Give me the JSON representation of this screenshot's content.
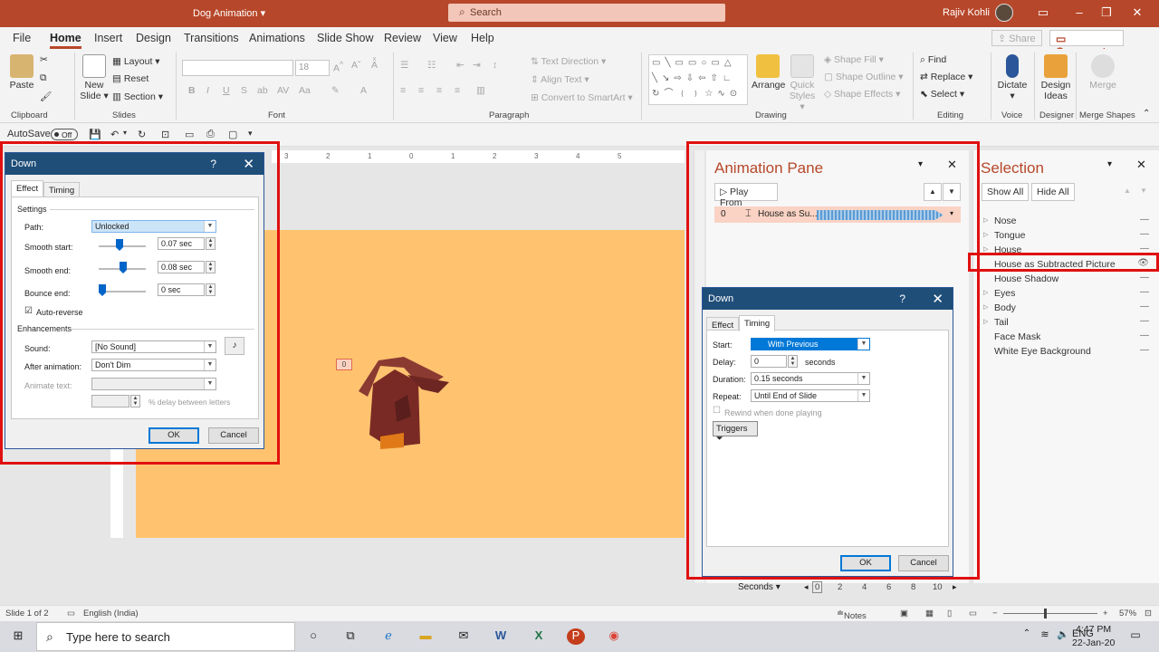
{
  "titlebar": {
    "doc_title": "Dog Animation ▾",
    "search_placeholder": "Search",
    "user": "Rajiv Kohli"
  },
  "tabs": [
    "File",
    "Home",
    "Insert",
    "Design",
    "Transitions",
    "Animations",
    "Slide Show",
    "Review",
    "View",
    "Help"
  ],
  "share": "Share",
  "comments": "Comments",
  "ribbon": {
    "clipboard": {
      "paste": "Paste",
      "label": "Clipboard"
    },
    "slides": {
      "new_slide": "New Slide ▾",
      "layout": "Layout ▾",
      "reset": "Reset",
      "section": "Section ▾",
      "label": "Slides"
    },
    "font": {
      "size": "18",
      "label": "Font"
    },
    "paragraph": {
      "text_direction": "Text Direction ▾",
      "align_text": "Align Text ▾",
      "convert": "Convert to SmartArt ▾",
      "label": "Paragraph"
    },
    "drawing": {
      "arrange": "Arrange",
      "quick_styles": "Quick Styles ▾",
      "shape_fill": "Shape Fill ▾",
      "shape_outline": "Shape Outline ▾",
      "shape_effects": "Shape Effects ▾",
      "label": "Drawing"
    },
    "editing": {
      "find": "Find",
      "replace": "Replace ▾",
      "select": "Select ▾",
      "label": "Editing"
    },
    "voice": {
      "dictate": "Dictate ▾",
      "label": "Voice"
    },
    "designer": {
      "ideas": "Design Ideas",
      "label": "Designer"
    },
    "merge": {
      "merge": "Merge",
      "label": "Merge Shapes"
    }
  },
  "qat": {
    "autosave": "AutoSave",
    "toggle": "Off"
  },
  "slide": {
    "tag": "0"
  },
  "effect_dialog": {
    "title": "Down",
    "tab_effect": "Effect",
    "tab_timing": "Timing",
    "settings": "Settings",
    "path_label": "Path:",
    "path_value": "Unlocked",
    "smooth_start_label": "Smooth start:",
    "smooth_start": "0.07 sec",
    "smooth_end_label": "Smooth end:",
    "smooth_end": "0.08 sec",
    "bounce_end_label": "Bounce end:",
    "bounce_end": "0 sec",
    "auto_reverse": "Auto-reverse",
    "enhancements": "Enhancements",
    "sound_label": "Sound:",
    "sound_value": "[No Sound]",
    "after_label": "After animation:",
    "after_value": "Don't Dim",
    "animate_text_label": "Animate text:",
    "delay_letters": "% delay between letters",
    "ok": "OK",
    "cancel": "Cancel"
  },
  "timing_dialog": {
    "title": "Down",
    "tab_effect": "Effect",
    "tab_timing": "Timing",
    "start_label": "Start:",
    "start_value": "With Previous",
    "delay_label": "Delay:",
    "delay_value": "0",
    "seconds": "seconds",
    "duration_label": "Duration:",
    "duration_value": "0.15 seconds",
    "repeat_label": "Repeat:",
    "repeat_value": "Until End of Slide",
    "rewind": "Rewind when done playing",
    "triggers": "Triggers",
    "ok": "OK",
    "cancel": "Cancel"
  },
  "anim_pane": {
    "title": "Animation Pane",
    "play_from": "Play From",
    "item_index": "0",
    "item_label": "House as Su...",
    "seconds": "Seconds ▾",
    "timeline": [
      "0",
      "2",
      "4",
      "6",
      "8",
      "10"
    ]
  },
  "selection_pane": {
    "title": "Selection",
    "show_all": "Show All",
    "hide_all": "Hide All",
    "items": [
      {
        "name": "Nose",
        "group": true
      },
      {
        "name": "Tongue",
        "group": true
      },
      {
        "name": "House",
        "group": true
      },
      {
        "name": "House as Subtracted Picture",
        "group": false
      },
      {
        "name": "House Shadow",
        "group": false
      },
      {
        "name": "Eyes",
        "group": true
      },
      {
        "name": "Body",
        "group": true
      },
      {
        "name": "Tail",
        "group": true
      },
      {
        "name": "Face Mask",
        "group": false
      },
      {
        "name": "White Eye Background",
        "group": false
      }
    ]
  },
  "status": {
    "slide": "Slide 1 of 2",
    "language": "English (India)",
    "notes": "Notes",
    "zoom": "57%"
  },
  "taskbar": {
    "search": "Type here to search",
    "time": "4:47 PM",
    "date": "22-Jan-20"
  },
  "colors": {
    "accent": "#b7472a",
    "slide_bg": "#ffc36f",
    "dialog_header": "#1f4e79",
    "annotation": "#e01010"
  }
}
